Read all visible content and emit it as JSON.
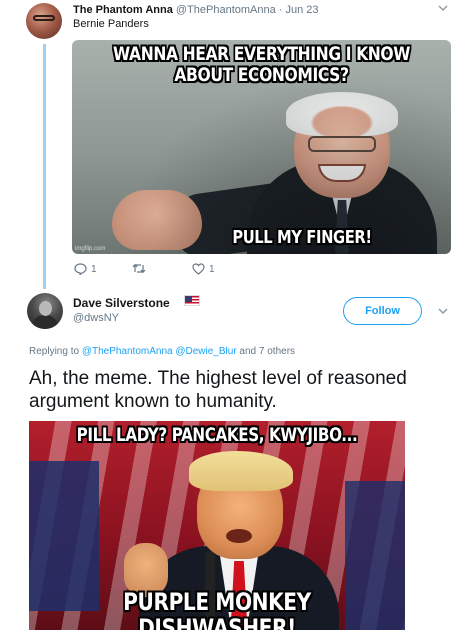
{
  "parent_tweet": {
    "author_name": "The Phantom Anna",
    "handle": "@ThePhantomAnna",
    "separator": " · ",
    "date": "Jun 23",
    "text": "Bernie Panders",
    "image": {
      "caption_top": "WANNA HEAR EVERYTHING I KNOW ABOUT ECONOMICS?",
      "caption_bottom": "PULL MY FINGER!",
      "watermark": "imgflip.com"
    },
    "actions": {
      "reply_count": "1",
      "retweet_count": "",
      "like_count": "1"
    },
    "icons": [
      "reply-icon",
      "retweet-icon",
      "like-icon",
      "chevron-down-icon"
    ]
  },
  "main_tweet": {
    "author_name": "Dave Silverstone",
    "handle": "@dwsNY",
    "follow_label": "Follow",
    "reply_prefix": "Replying to ",
    "reply_mention_1": "@ThePhantomAnna",
    "reply_mention_2": "@Dewie_Blur",
    "reply_suffix": " and 7 others",
    "text": "Ah, the meme. The highest level of reasoned argument known to humanity.",
    "image": {
      "caption_top": "PILL LADY? PANCAKES, KWYJIBO...",
      "caption_bottom": "PURPLE MONKEY DISHWASHER!"
    },
    "icons": [
      "us-flag-icon",
      "chevron-down-icon"
    ]
  },
  "colors": {
    "accent": "#1da1f2",
    "thread_line": "#9fd0f5",
    "secondary_text": "#657786",
    "primary_text": "#14171a"
  }
}
